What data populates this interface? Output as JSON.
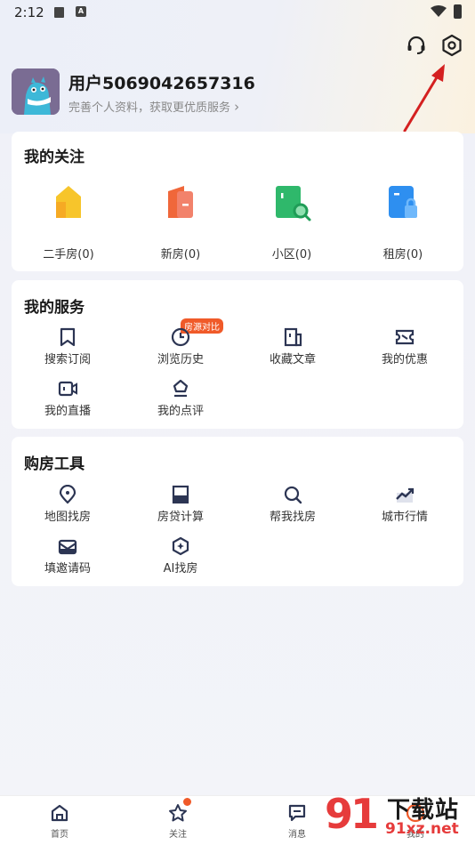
{
  "status_bar": {
    "time": "2:12",
    "icon_a": "A"
  },
  "header": {
    "support_icon": "headset-icon",
    "settings_icon": "gear-icon"
  },
  "profile": {
    "username": "用户5069042657316",
    "subtitle": "完善个人资料，获取更优质服务",
    "chevron": "›"
  },
  "follow": {
    "title": "我的关注",
    "items": [
      {
        "label": "二手房(0)",
        "icon": "house-icon",
        "color": "#f7c52b"
      },
      {
        "label": "新房(0)",
        "icon": "building-icon",
        "color": "#f0673a"
      },
      {
        "label": "小区(0)",
        "icon": "community-icon",
        "color": "#2fb86b"
      },
      {
        "label": "租房(0)",
        "icon": "rent-icon",
        "color": "#2e8ff0"
      }
    ]
  },
  "services": {
    "title": "我的服务",
    "badge": "房源对比",
    "items": [
      {
        "label": "搜索订阅",
        "icon": "bookmark-icon"
      },
      {
        "label": "浏览历史",
        "icon": "clock-icon"
      },
      {
        "label": "收藏文章",
        "icon": "article-icon"
      },
      {
        "label": "我的优惠",
        "icon": "ticket-icon"
      },
      {
        "label": "我的直播",
        "icon": "video-icon"
      },
      {
        "label": "我的点评",
        "icon": "review-icon"
      }
    ]
  },
  "tools": {
    "title": "购房工具",
    "items": [
      {
        "label": "地图找房",
        "icon": "map-pin-icon"
      },
      {
        "label": "房贷计算",
        "icon": "calculator-icon"
      },
      {
        "label": "帮我找房",
        "icon": "search-icon"
      },
      {
        "label": "城市行情",
        "icon": "trend-icon"
      },
      {
        "label": "填邀请码",
        "icon": "mail-icon"
      },
      {
        "label": "AI找房",
        "icon": "ai-icon"
      }
    ]
  },
  "bottom_nav": [
    {
      "label": "首页",
      "icon": "home-icon"
    },
    {
      "label": "关注",
      "icon": "star-icon"
    },
    {
      "label": "消息",
      "icon": "message-icon"
    },
    {
      "label": "我的",
      "icon": "profile-icon"
    }
  ],
  "watermark": {
    "logo": "91",
    "text1": "下载站",
    "text2": "91xz.net"
  },
  "colors": {
    "accent": "#f05a29",
    "icon_navy": "#2c3553"
  }
}
